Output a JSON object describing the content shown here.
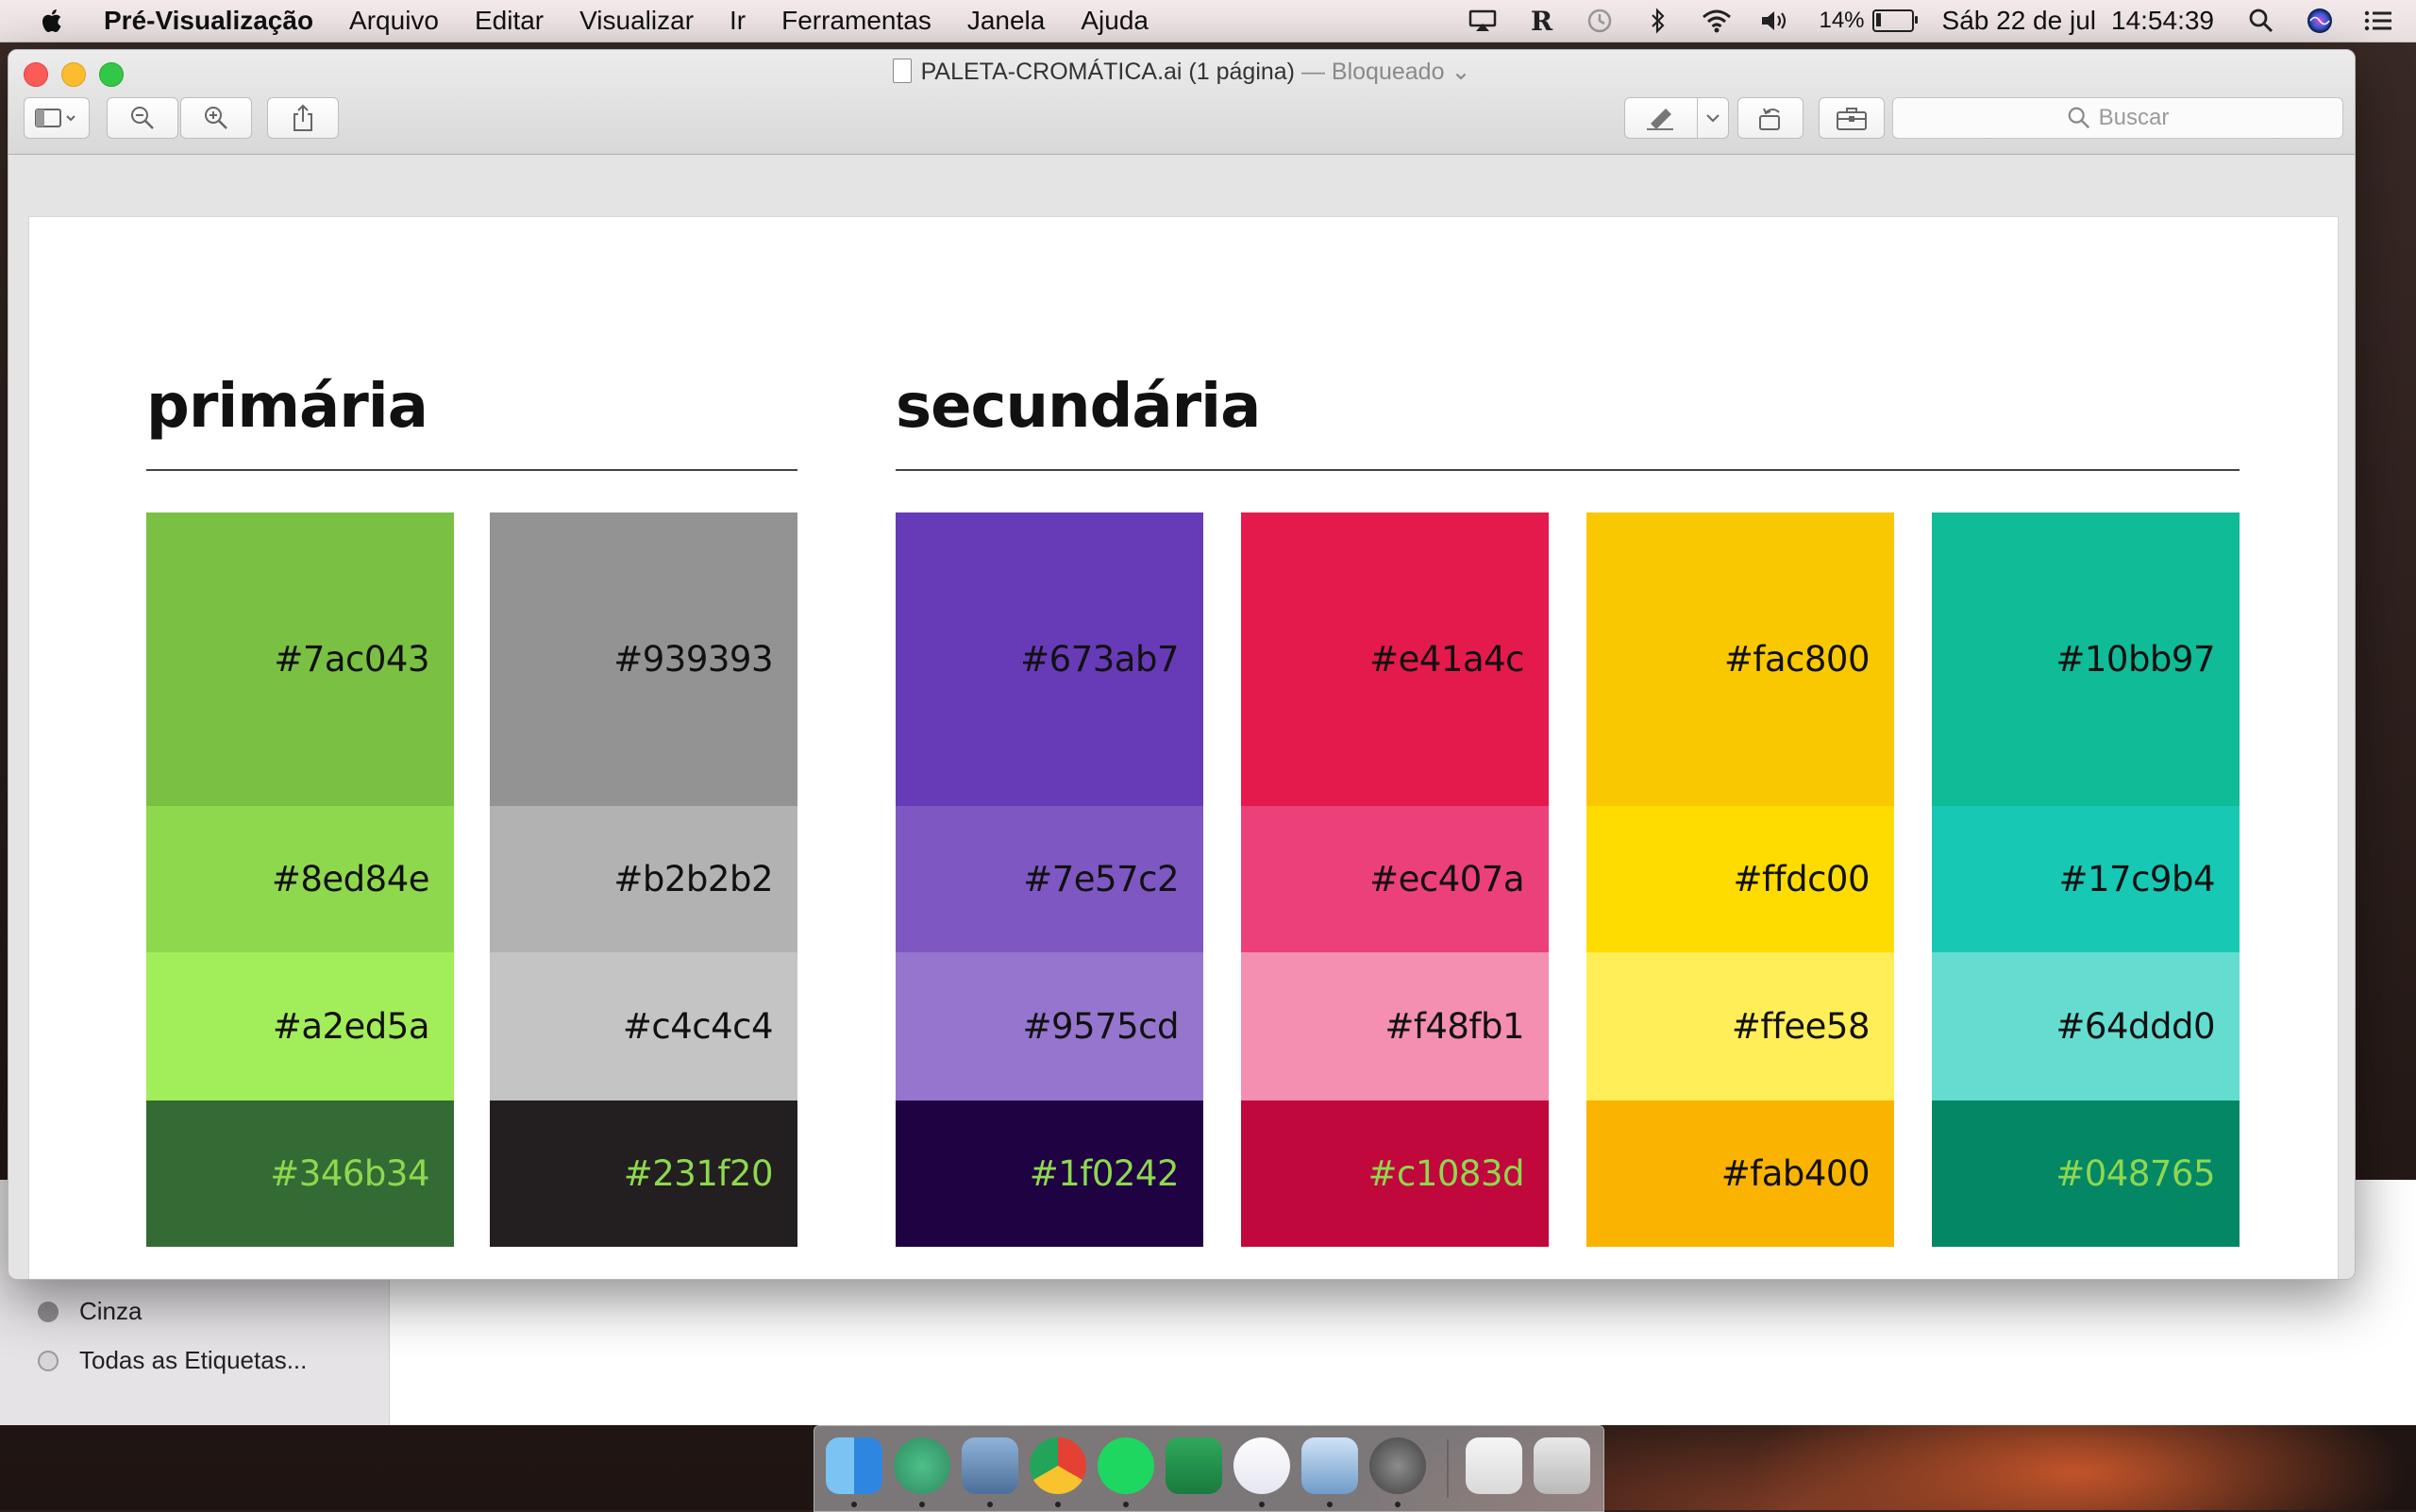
{
  "menubar": {
    "app_name": "Pré-Visualização",
    "menus": [
      "Arquivo",
      "Editar",
      "Visualizar",
      "Ir",
      "Ferramentas",
      "Janela",
      "Ajuda"
    ],
    "battery_percent": "14%",
    "battery_level": 0.14,
    "date": "Sáb 22 de jul",
    "time": "14:54:39",
    "status_icons": [
      "airplay-icon",
      "r-icon",
      "time-machine-icon",
      "bluetooth-icon",
      "wifi-icon",
      "volume-icon"
    ]
  },
  "window": {
    "title": "PALETA-CROMÁTICA.ai (1 página)",
    "title_suffix": "— Bloqueado",
    "toolbar": {
      "search_placeholder": "Buscar"
    }
  },
  "document": {
    "primary_title": "primária",
    "secondary_title": "secundária",
    "primary": [
      {
        "swatches": [
          {
            "hex": "#7ac043",
            "label": "#7ac043",
            "text_color": "#111111"
          },
          {
            "hex": "#8ed84e",
            "label": "#8ed84e",
            "text_color": "#111111"
          },
          {
            "hex": "#a2ed5a",
            "label": "#a2ed5a",
            "text_color": "#111111"
          },
          {
            "hex": "#346b34",
            "label": "#346b34",
            "text_color": "#8ed84e"
          }
        ]
      },
      {
        "swatches": [
          {
            "hex": "#939393",
            "label": "#939393",
            "text_color": "#111111"
          },
          {
            "hex": "#b2b2b2",
            "label": "#b2b2b2",
            "text_color": "#111111"
          },
          {
            "hex": "#c4c4c4",
            "label": "#c4c4c4",
            "text_color": "#111111"
          },
          {
            "hex": "#231f20",
            "label": "#231f20",
            "text_color": "#8ed84e"
          }
        ]
      }
    ],
    "secondary": [
      {
        "swatches": [
          {
            "hex": "#673ab7",
            "label": "#673ab7",
            "text_color": "#111111"
          },
          {
            "hex": "#7e57c2",
            "label": "#7e57c2",
            "text_color": "#111111"
          },
          {
            "hex": "#9575cd",
            "label": "#9575cd",
            "text_color": "#111111"
          },
          {
            "hex": "#1f0242",
            "label": "#1f0242",
            "text_color": "#8ed84e"
          }
        ]
      },
      {
        "swatches": [
          {
            "hex": "#e41a4c",
            "label": "#e41a4c",
            "text_color": "#111111"
          },
          {
            "hex": "#ec407a",
            "label": "#ec407a",
            "text_color": "#111111"
          },
          {
            "hex": "#f48fb1",
            "label": "#f48fb1",
            "text_color": "#111111"
          },
          {
            "hex": "#c1083d",
            "label": "#c1083d",
            "text_color": "#8ed84e"
          }
        ]
      },
      {
        "swatches": [
          {
            "hex": "#fac800",
            "label": "#fac800",
            "text_color": "#111111"
          },
          {
            "hex": "#ffdc00",
            "label": "#ffdc00",
            "text_color": "#111111"
          },
          {
            "hex": "#ffee58",
            "label": "#ffee58",
            "text_color": "#111111"
          },
          {
            "hex": "#fab400",
            "label": "#fab400",
            "text_color": "#111111"
          }
        ]
      },
      {
        "swatches": [
          {
            "hex": "#10bb97",
            "label": "#10bb97",
            "text_color": "#111111"
          },
          {
            "hex": "#17c9b4",
            "label": "#17c9b4",
            "text_color": "#111111"
          },
          {
            "hex": "#64ddd0",
            "label": "#64ddd0",
            "text_color": "#111111"
          },
          {
            "hex": "#048765",
            "label": "#048765",
            "text_color": "#8ed84e"
          }
        ]
      }
    ]
  },
  "finder": {
    "tags": [
      {
        "label": "Cinza",
        "color": "#8e8e8e"
      },
      {
        "label": "Todas as Etiquetas...",
        "color": "#d6d6d6"
      }
    ]
  },
  "dock": {
    "apps": [
      "finder-icon",
      "atom-icon",
      "mail-icon",
      "chrome-icon",
      "spotify-icon",
      "excel-icon",
      "itunes-icon",
      "preview-icon",
      "system-preferences-icon",
      "hogwarts-icon",
      "trash-icon"
    ]
  }
}
